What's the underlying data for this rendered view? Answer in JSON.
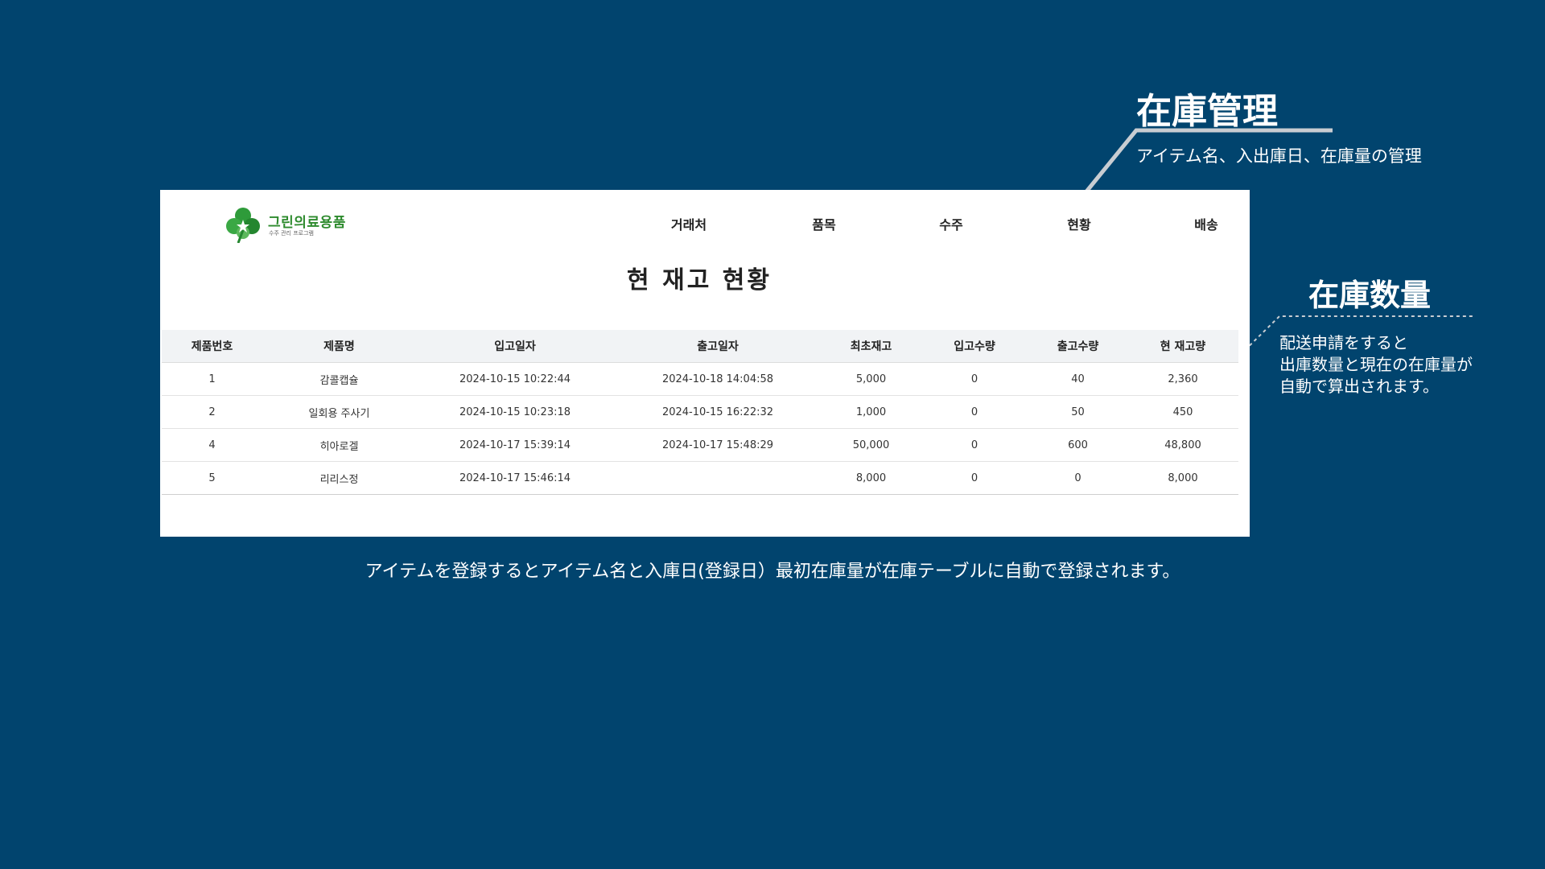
{
  "callouts": {
    "management": {
      "title": "在庫管理",
      "text": "アイテム名、入出庫日、在庫量の管理"
    },
    "quantity": {
      "title": "在庫数量",
      "lines": [
        "配送申請をすると",
        "出庫数量と現在の在庫量が",
        "自動で算出されます。"
      ]
    }
  },
  "caption": "アイテムを登録するとアイテム名と入庫日(登録日）最初在庫量が在庫テーブルに自動で登録されます。",
  "app": {
    "logo": {
      "name": "그린의료용품",
      "sub": "수주 관리 프로그램",
      "icon": "clover-icon"
    },
    "nav": [
      "거래처",
      "품목",
      "수주",
      "현황",
      "배송"
    ],
    "page_title": "현 재고 현황",
    "table": {
      "headers": [
        "제품번호",
        "제품명",
        "입고일자",
        "출고일자",
        "최초재고",
        "입고수량",
        "출고수량",
        "현 재고량"
      ],
      "rows": [
        [
          "1",
          "감콜캡슐",
          "2024-10-15 10:22:44",
          "2024-10-18 14:04:58",
          "5,000",
          "0",
          "40",
          "2,360"
        ],
        [
          "2",
          "일회용 주사기",
          "2024-10-15 10:23:18",
          "2024-10-15 16:22:32",
          "1,000",
          "0",
          "50",
          "450"
        ],
        [
          "4",
          "히아로겔",
          "2024-10-17 15:39:14",
          "2024-10-17 15:48:29",
          "50,000",
          "0",
          "600",
          "48,800"
        ],
        [
          "5",
          "리리스정",
          "2024-10-17 15:46:14",
          "",
          "8,000",
          "0",
          "0",
          "8,000"
        ]
      ]
    }
  },
  "colors": {
    "background": "#01446e",
    "panel": "#ffffff",
    "brand_green": "#2e8b2e",
    "connector": "#c8cdd2"
  }
}
